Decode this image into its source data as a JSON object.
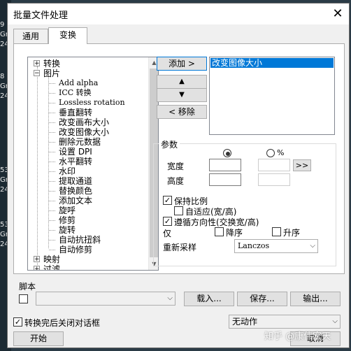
{
  "background": {
    "desktop_texts": [
      "9",
      "Gr",
      "24",
      "8",
      "Gr",
      "24",
      "53",
      "Gr",
      "24",
      "53",
      "Gr",
      "24"
    ]
  },
  "dialog": {
    "title": "批量文件处理",
    "close_glyph": "✕",
    "tabs": [
      {
        "label": "通用"
      },
      {
        "label": "变换"
      }
    ],
    "active_tab": "变换"
  },
  "tree": {
    "items": [
      {
        "label": "转换",
        "type": "group",
        "expander": "+"
      },
      {
        "label": "图片",
        "type": "group",
        "expander": "−"
      },
      {
        "label": "Add alpha",
        "type": "child"
      },
      {
        "label": "ICC 转换",
        "type": "child"
      },
      {
        "label": "Lossless rotation",
        "type": "child"
      },
      {
        "label": "垂直翻转",
        "type": "child"
      },
      {
        "label": "改变画布大小",
        "type": "child"
      },
      {
        "label": "改变图像大小",
        "type": "child"
      },
      {
        "label": "删除元数据",
        "type": "child"
      },
      {
        "label": "设置 DPI",
        "type": "child"
      },
      {
        "label": "水平翻转",
        "type": "child"
      },
      {
        "label": "水印",
        "type": "child"
      },
      {
        "label": "提取通道",
        "type": "child"
      },
      {
        "label": "替换颜色",
        "type": "child"
      },
      {
        "label": "添加文本",
        "type": "child"
      },
      {
        "label": "旋呼",
        "type": "child"
      },
      {
        "label": "修剪",
        "type": "child"
      },
      {
        "label": "旋转",
        "type": "child"
      },
      {
        "label": "自动抗扭斜",
        "type": "child"
      },
      {
        "label": "自动修剪",
        "type": "child"
      },
      {
        "label": "映射",
        "type": "group",
        "expander": "+"
      },
      {
        "label": "过滤",
        "type": "group",
        "expander": "+"
      }
    ]
  },
  "buttons": {
    "add": "添加 >",
    "up": "▲",
    "down": "▼",
    "remove": "< 移除",
    "load": "载入...",
    "save": "保存...",
    "export": "输出...",
    "start": "开始",
    "cancel": "取消",
    "more": ">>"
  },
  "operations_list": {
    "items": [
      "改变图像大小"
    ],
    "selected": "改变图像大小"
  },
  "params": {
    "title": "参数",
    "radio_pixel_selected": true,
    "radio_percent_label": "%",
    "width_label": "宽度",
    "height_label": "高度",
    "width_value": "",
    "height_value": "",
    "keep_ratio_label": "保持比例",
    "keep_ratio_checked": true,
    "adaptive_label": "自适应(宽/高)",
    "adaptive_checked": false,
    "follow_orientation_label": "遵循方向性(交换宽/高)",
    "follow_orientation_checked": true,
    "only_label": "仅",
    "decrease_label": "降序",
    "increase_label": "升序",
    "resample_label": "重新采样",
    "resample_value": "Lanczos"
  },
  "script": {
    "label": "脚本",
    "checked": false,
    "value": ""
  },
  "footer": {
    "close_after_label": "转换完后关闭对话框",
    "close_after_checked": true,
    "action_value": "无动作"
  },
  "watermark": "知乎 @康伟宏天"
}
